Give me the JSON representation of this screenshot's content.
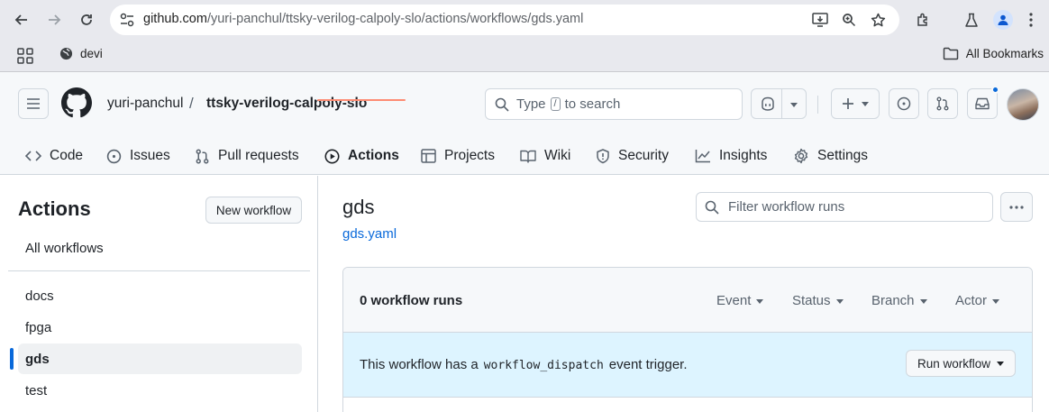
{
  "browser": {
    "url_host": "github.com",
    "url_path": "/yuri-panchul/ttsky-verilog-calpoly-slo/actions/workflows/gds.yaml",
    "bookmarks": [
      {
        "label": "devi"
      }
    ],
    "all_bookmarks_label": "All Bookmarks"
  },
  "header": {
    "owner": "yuri-panchul",
    "separator": "/",
    "repo": "ttsky-verilog-calpoly-slo",
    "search_prefix": "Type",
    "search_key": "/",
    "search_suffix": "to search"
  },
  "repo_nav": {
    "tabs": [
      {
        "label": "Code",
        "icon": "code-icon"
      },
      {
        "label": "Issues",
        "icon": "issue-icon"
      },
      {
        "label": "Pull requests",
        "icon": "pull-request-icon"
      },
      {
        "label": "Actions",
        "icon": "play-icon",
        "active": true
      },
      {
        "label": "Projects",
        "icon": "table-icon"
      },
      {
        "label": "Wiki",
        "icon": "book-icon"
      },
      {
        "label": "Security",
        "icon": "shield-icon"
      },
      {
        "label": "Insights",
        "icon": "graph-icon"
      },
      {
        "label": "Settings",
        "icon": "gear-icon"
      }
    ],
    "accent_color": "#fd8c73"
  },
  "sidebar": {
    "title": "Actions",
    "new_workflow_label": "New workflow",
    "all_workflows_label": "All workflows",
    "workflows": [
      {
        "label": "docs"
      },
      {
        "label": "fpga"
      },
      {
        "label": "gds",
        "active": true
      },
      {
        "label": "test"
      }
    ]
  },
  "main": {
    "title": "gds",
    "file_link": "gds.yaml",
    "filter_placeholder": "Filter workflow runs",
    "runs_count": "0 workflow runs",
    "filters": [
      {
        "label": "Event"
      },
      {
        "label": "Status"
      },
      {
        "label": "Branch"
      },
      {
        "label": "Actor"
      }
    ],
    "dispatch_before": "This workflow has a",
    "dispatch_code": "workflow_dispatch",
    "dispatch_after": "event trigger.",
    "run_workflow_label": "Run workflow"
  }
}
